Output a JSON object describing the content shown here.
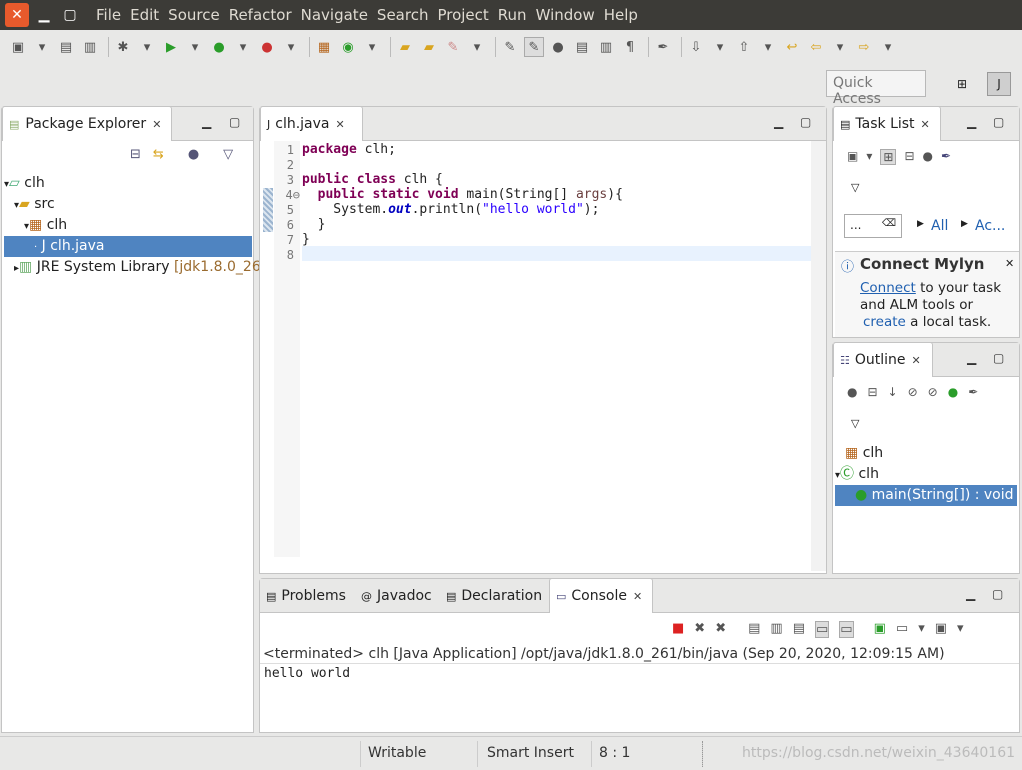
{
  "menu": [
    "File",
    "Edit",
    "Source",
    "Refactor",
    "Navigate",
    "Search",
    "Project",
    "Run",
    "Window",
    "Help"
  ],
  "quick_access": {
    "placeholder": "Quick Access"
  },
  "package_explorer": {
    "title": "Package Explorer",
    "tree": [
      {
        "label": "clh",
        "indent": 0,
        "arrow": "▾",
        "icon": "project-icon"
      },
      {
        "label": "src",
        "indent": 1,
        "arrow": "▾",
        "icon": "source-folder-icon"
      },
      {
        "label": "clh",
        "indent": 2,
        "arrow": "▾",
        "icon": "package-icon"
      },
      {
        "label": "clh.java",
        "indent": 3,
        "arrow": "·",
        "icon": "java-file-icon",
        "selected": true
      },
      {
        "label": "JRE System Library",
        "indent": 1,
        "arrow": "▸",
        "icon": "library-icon",
        "extra": "[jdk1.8.0_26"
      }
    ]
  },
  "editor": {
    "tab": "clh.java",
    "lines": [
      "1",
      "2",
      "3",
      "4⊖",
      "5",
      "6",
      "7",
      "8"
    ]
  },
  "task_list": {
    "title": "Task List",
    "filter_all": "All",
    "filter_ac": "Ac...",
    "search_placeholder": "...",
    "connect_title": "Connect Mylyn",
    "connect_link": "Connect",
    "connect_text1": "to your task",
    "connect_text2": "and ALM tools or",
    "create_link": "create",
    "connect_text3": "a local task."
  },
  "outline": {
    "title": "Outline",
    "items": [
      {
        "label": "clh",
        "icon": "package-icon"
      },
      {
        "label": "clh",
        "icon": "class-icon"
      },
      {
        "label": "main(String[]) : void",
        "icon": "method-icon",
        "selected": true
      }
    ]
  },
  "bottom_tabs": [
    "Problems",
    "Javadoc",
    "Declaration",
    "Console"
  ],
  "console": {
    "header": "<terminated> clh [Java Application] /opt/java/jdk1.8.0_261/bin/java (Sep 20, 2020, 12:09:15 AM)",
    "output": "hello world"
  },
  "status": {
    "writable": "Writable",
    "insert": "Smart Insert",
    "position": "8 : 1",
    "watermark": "https://blog.csdn.net/weixin_43640161"
  }
}
